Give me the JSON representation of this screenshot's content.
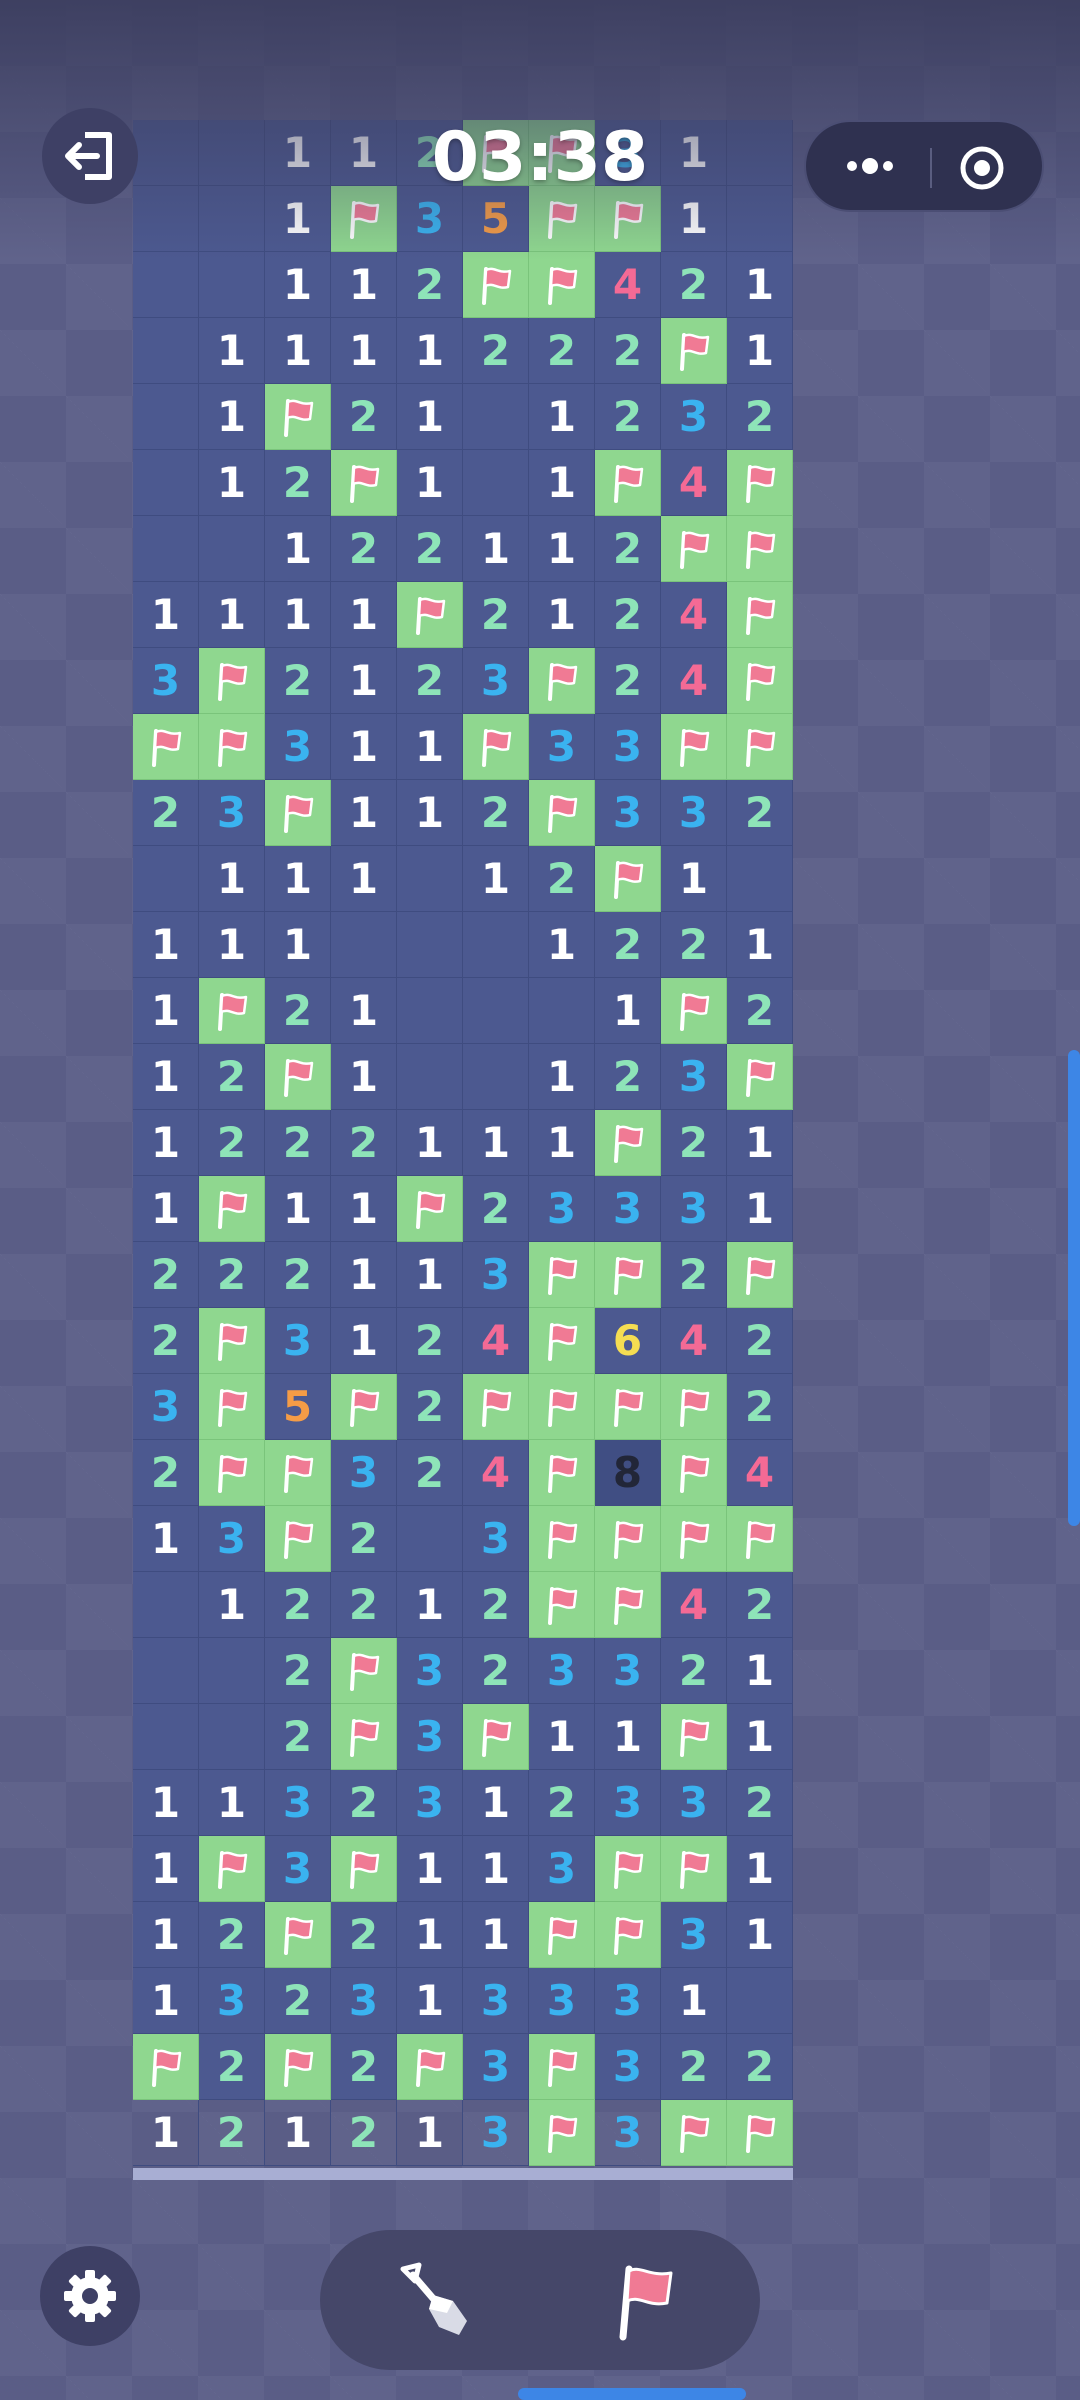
{
  "game": {
    "timer": "03:38",
    "columns": 10,
    "rows": 31,
    "grid": [
      [
        ".",
        ".",
        "1",
        "1",
        "2",
        "F",
        "F",
        "3",
        "1",
        "."
      ],
      [
        ".",
        ".",
        "1",
        "F",
        "3",
        "5",
        "F",
        "F",
        "1",
        "."
      ],
      [
        ".",
        ".",
        "1",
        "1",
        "2",
        "F",
        "F",
        "4",
        "2",
        "1"
      ],
      [
        ".",
        "1",
        "1",
        "1",
        "1",
        "2",
        "2",
        "2",
        "F",
        "1"
      ],
      [
        ".",
        "1",
        "F",
        "2",
        "1",
        ".",
        "1",
        "2",
        "3",
        "2"
      ],
      [
        ".",
        "1",
        "2",
        "F",
        "1",
        ".",
        "1",
        "F",
        "4",
        "F"
      ],
      [
        ".",
        ".",
        "1",
        "2",
        "2",
        "1",
        "1",
        "2",
        "F",
        "F"
      ],
      [
        "1",
        "1",
        "1",
        "1",
        "F",
        "2",
        "1",
        "2",
        "4",
        "F"
      ],
      [
        "3",
        "F",
        "2",
        "1",
        "2",
        "3",
        "F",
        "2",
        "4",
        "F"
      ],
      [
        "F",
        "F",
        "3",
        "1",
        "1",
        "F",
        "3",
        "3",
        "F",
        "F"
      ],
      [
        "2",
        "3",
        "F",
        "1",
        "1",
        "2",
        "F",
        "3",
        "3",
        "2"
      ],
      [
        ".",
        "1",
        "1",
        "1",
        ".",
        "1",
        "2",
        "F",
        "1",
        "."
      ],
      [
        "1",
        "1",
        "1",
        ".",
        ".",
        ".",
        "1",
        "2",
        "2",
        "1"
      ],
      [
        "1",
        "F",
        "2",
        "1",
        ".",
        ".",
        ".",
        "1",
        "F",
        "2"
      ],
      [
        "1",
        "2",
        "F",
        "1",
        ".",
        ".",
        "1",
        "2",
        "3",
        "F"
      ],
      [
        "1",
        "2",
        "2",
        "2",
        "1",
        "1",
        "1",
        "F",
        "2",
        "1"
      ],
      [
        "1",
        "F",
        "1",
        "1",
        "F",
        "2",
        "3",
        "3",
        "3",
        "1"
      ],
      [
        "2",
        "2",
        "2",
        "1",
        "1",
        "3",
        "F",
        "F",
        "2",
        "F"
      ],
      [
        "2",
        "F",
        "3",
        "1",
        "2",
        "4",
        "F",
        "6",
        "4",
        "2"
      ],
      [
        "3",
        "F",
        "5",
        "F",
        "2",
        "F",
        "F",
        "F",
        "F",
        "2"
      ],
      [
        "2",
        "F",
        "F",
        "3",
        "2",
        "4",
        "F",
        "8",
        "F",
        "4"
      ],
      [
        "1",
        "3",
        "F",
        "2",
        ".",
        "3",
        "F",
        "F",
        "F",
        "F"
      ],
      [
        ".",
        "1",
        "2",
        "2",
        "1",
        "2",
        "F",
        "F",
        "4",
        "2"
      ],
      [
        ".",
        ".",
        "2",
        "F",
        "3",
        "2",
        "3",
        "3",
        "2",
        "1"
      ],
      [
        ".",
        ".",
        "2",
        "F",
        "3",
        "F",
        "1",
        "1",
        "F",
        "1"
      ],
      [
        "1",
        "1",
        "3",
        "2",
        "3",
        "1",
        "2",
        "3",
        "3",
        "2"
      ],
      [
        "1",
        "F",
        "3",
        "F",
        "1",
        "1",
        "3",
        "F",
        "F",
        "1"
      ],
      [
        "1",
        "2",
        "F",
        "2",
        "1",
        "1",
        "F",
        "F",
        "3",
        "1"
      ],
      [
        "1",
        "3",
        "2",
        "3",
        "1",
        "3",
        "3",
        "3",
        "1",
        "."
      ],
      [
        "F",
        "2",
        "F",
        "2",
        "F",
        "3",
        "F",
        "3",
        "2",
        "2"
      ],
      [
        "1",
        "2",
        "1",
        "2",
        "1",
        "3",
        "F",
        "3",
        "F",
        "F"
      ]
    ]
  },
  "colors": {
    "board": "#4c5990",
    "flag_cell": "#8fd78f",
    "flag": "#f07a94",
    "n1": "#ffffff",
    "n2": "#8ee4b8",
    "n3": "#3ab3f0",
    "n4": "#f46a95",
    "n5": "#f59c46",
    "n6": "#f5dd52",
    "n8": "#222638",
    "accent": "#3d86e6"
  },
  "icons": {
    "exit": "exit-icon",
    "more": "more-dots-icon",
    "target": "target-icon",
    "settings": "gear-icon",
    "dig_tool": "shovel-icon",
    "flag_tool": "flag-icon"
  }
}
